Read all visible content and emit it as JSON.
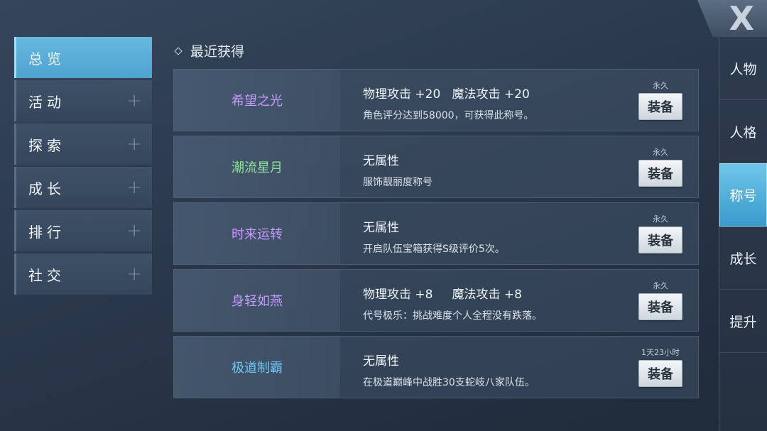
{
  "close": {
    "glyph": "X"
  },
  "left_menu": [
    {
      "label": "总览",
      "active": true,
      "expand": ""
    },
    {
      "label": "活动",
      "active": false,
      "expand": "+"
    },
    {
      "label": "探索",
      "active": false,
      "expand": "+"
    },
    {
      "label": "成长",
      "active": false,
      "expand": "+"
    },
    {
      "label": "排行",
      "active": false,
      "expand": "+"
    },
    {
      "label": "社交",
      "active": false,
      "expand": "+"
    }
  ],
  "section": {
    "title": "最近获得"
  },
  "titles": [
    {
      "name": "希望之光",
      "name_color": "#c79bff",
      "attr": "物理攻击 +20   魔法攻击 +20",
      "desc": "角色评分达到58000，可获得此称号。",
      "duration": "永久",
      "button": "装备"
    },
    {
      "name": "潮流星月",
      "name_color": "#8fe39a",
      "attr": "无属性",
      "desc": "服饰靓丽度称号",
      "duration": "永久",
      "button": "装备"
    },
    {
      "name": "时来运转",
      "name_color": "#c79bff",
      "attr": "无属性",
      "desc": "开启队伍宝箱获得S级评价5次。",
      "duration": "永久",
      "button": "装备"
    },
    {
      "name": "身轻如燕",
      "name_color": "#c79bff",
      "attr": "物理攻击 +8     魔法攻击 +8",
      "desc": "代号极乐：挑战难度个人全程没有跌落。",
      "duration": "永久",
      "button": "装备"
    },
    {
      "name": "极道制霸",
      "name_color": "#6fc6f5",
      "attr": "无属性",
      "desc": "在极道巅峰中战胜30支蛇岐八家队伍。",
      "duration": "1天23小时",
      "button": "装备"
    }
  ],
  "right_tabs": [
    {
      "label": "人物",
      "active": false
    },
    {
      "label": "人格",
      "active": false
    },
    {
      "label": "称号",
      "active": true
    },
    {
      "label": "成长",
      "active": false
    },
    {
      "label": "提升",
      "active": false
    }
  ]
}
